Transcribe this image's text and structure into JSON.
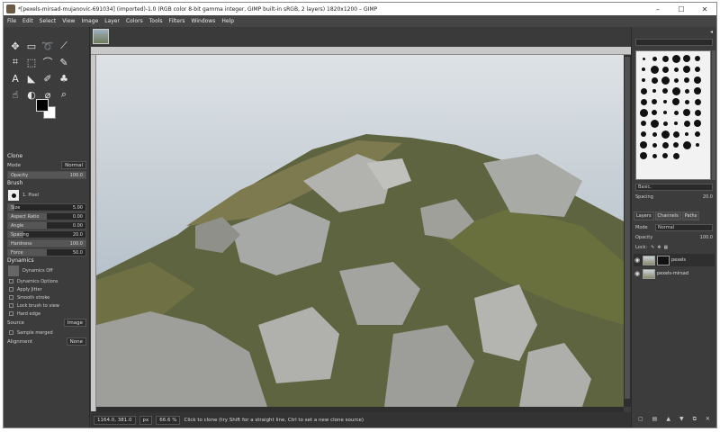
{
  "window": {
    "title": "*[pexels-mirsad-mujanovic-691034] (imported)-1.0 (RGB color 8-bit gamma integer, GIMP built-in sRGB, 2 layers) 1820x1200 – GIMP",
    "min": "–",
    "max": "☐",
    "close": "✕"
  },
  "menu": [
    "File",
    "Edit",
    "Select",
    "View",
    "Image",
    "Layer",
    "Colors",
    "Tools",
    "Filters",
    "Windows",
    "Help"
  ],
  "tool_options": {
    "title": "Clone",
    "mode_label": "Mode",
    "mode_value": "Normal",
    "opacity_label": "Opacity",
    "opacity_value": "100.0",
    "brush_label": "Brush",
    "brush_name": "1. Pixel",
    "sliders": [
      {
        "label": "Size",
        "value": "5.00",
        "fill": 0.08
      },
      {
        "label": "Aspect Ratio",
        "value": "0.00",
        "fill": 0.5
      },
      {
        "label": "Angle",
        "value": "0.00",
        "fill": 0.5
      },
      {
        "label": "Spacing",
        "value": "20.0",
        "fill": 0.2
      },
      {
        "label": "Hardness",
        "value": "100.0",
        "fill": 1.0
      },
      {
        "label": "Force",
        "value": "50.0",
        "fill": 0.5
      }
    ],
    "dynamics_label": "Dynamics",
    "dynamics_name": "Dynamics Off",
    "checks": [
      "Dynamics Options",
      "Apply Jitter",
      "Smooth stroke",
      "Lock brush to view",
      "Hard edge"
    ],
    "source_label": "Source",
    "source_value": "Image",
    "sample_merged": "Sample merged",
    "alignment_label": "Alignment",
    "alignment_value": "None"
  },
  "status": {
    "coords": "1164.0, 381.0",
    "unit": "px",
    "zoom": "66.6 %",
    "message": "Click to clone (try Shift for a straight line, Ctrl to set a new clone source)"
  },
  "right": {
    "preset": "Basic,",
    "spacing_label": "Spacing",
    "spacing_value": "20.0",
    "tabs": [
      "Layers",
      "Channels",
      "Paths"
    ],
    "mode_label": "Mode",
    "mode_value": "Normal",
    "opacity_label": "Opacity",
    "opacity_value": "100.0",
    "lock_label": "Lock:",
    "layers": [
      "pexels",
      "pexels-mirsad"
    ]
  },
  "colors": {
    "accent": "#3c3c3c",
    "sky": "#c9d2da"
  }
}
